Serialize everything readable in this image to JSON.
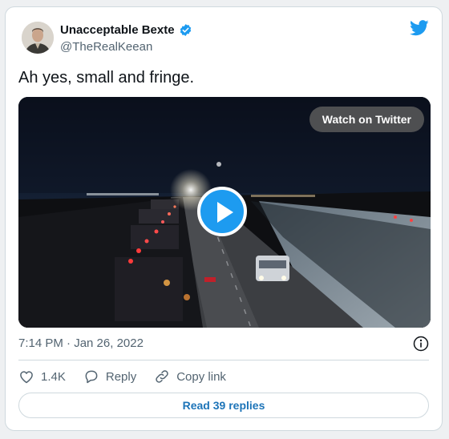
{
  "author": {
    "display_name": "Unacceptable Bexte",
    "handle": "@TheRealKeean",
    "verified": true
  },
  "tweet": {
    "text": "Ah yes, small and fringe.",
    "timestamp": "7:14 PM · Jan 26, 2022"
  },
  "media": {
    "watch_label": "Watch on Twitter"
  },
  "actions": {
    "likes": "1.4K",
    "reply_label": "Reply",
    "copy_link_label": "Copy link"
  },
  "footer": {
    "replies_label": "Read 39 replies"
  },
  "colors": {
    "accent": "#1d9bf0",
    "link_text": "#1d74b8",
    "muted": "#536471"
  },
  "icons": [
    "verified-badge-icon",
    "twitter-bird-icon",
    "play-icon",
    "info-icon",
    "heart-icon",
    "reply-icon",
    "link-icon"
  ]
}
